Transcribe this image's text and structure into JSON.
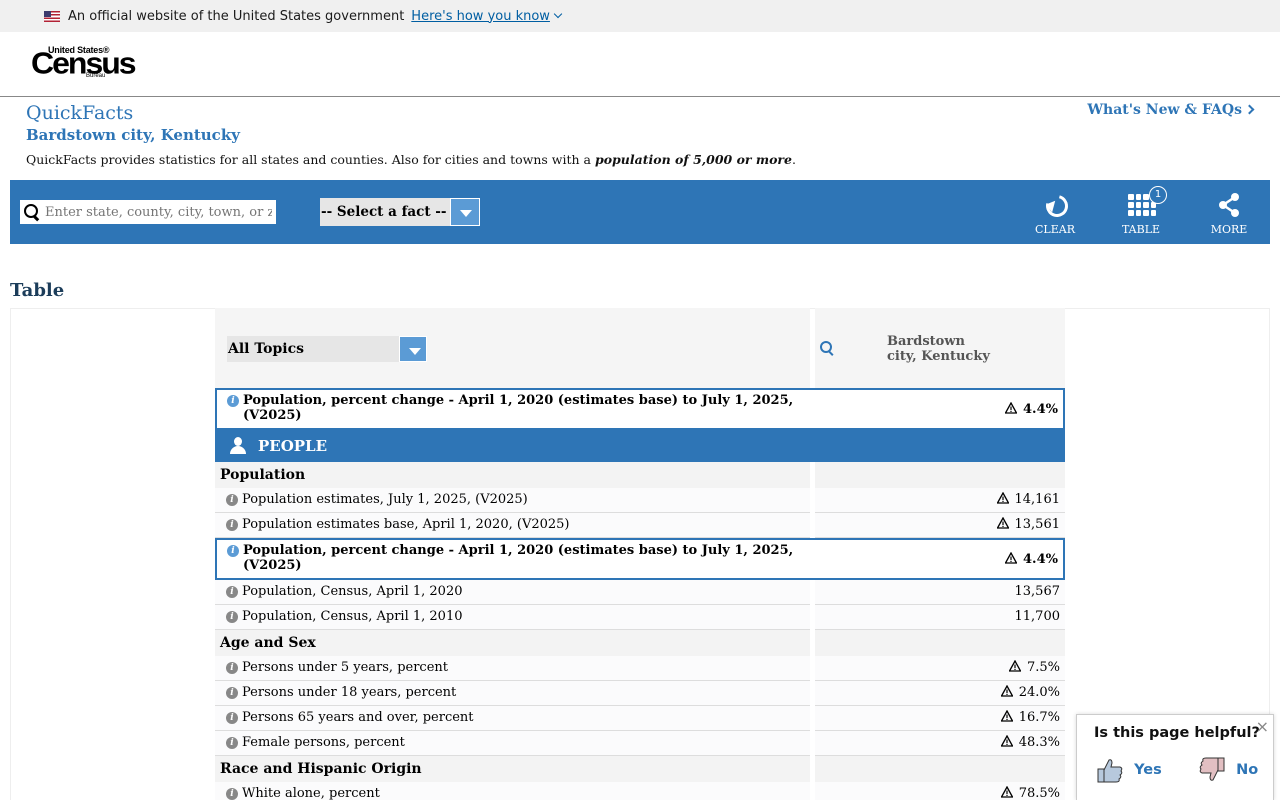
{
  "gov_banner": {
    "text": "An official website of the United States government",
    "link": "Here's how you know"
  },
  "logo": {
    "line1": "United States®",
    "line2": "Census",
    "line3": "Bureau"
  },
  "page": {
    "title": "QuickFacts",
    "subtitle": "Bardstown city, Kentucky",
    "whats_new": "What's New & FAQs",
    "description": "QuickFacts provides statistics for all states and counties. Also for cities and towns with a",
    "description_em": "population of 5,000 or more",
    "description_end": "."
  },
  "toolbar": {
    "search_placeholder": "Enter state, county, city, town, or zip code",
    "select_fact": "-- Select a fact --",
    "clear": "CLEAR",
    "table": "TABLE",
    "table_count": "1",
    "more": "MORE"
  },
  "table_heading": "Table",
  "table": {
    "topics": "All Topics",
    "column_line1": "Bardstown",
    "column_line2": "city, Kentucky",
    "highlight_top": {
      "label_line1": "Population, percent change - April 1, 2020 (estimates base) to July 1, 2025,",
      "label_line2": "(V2025)",
      "value": "4.4%"
    },
    "section": "PEOPLE",
    "groups": [
      {
        "category": "Population",
        "rows": [
          {
            "label": "Population estimates, July 1, 2025, (V2025)",
            "value": "14,161",
            "warn": true
          },
          {
            "label": "Population estimates base, April 1, 2020, (V2025)",
            "value": "13,561",
            "warn": true
          }
        ]
      }
    ],
    "highlight_mid": {
      "label_line1": "Population, percent change - April 1, 2020 (estimates base) to July 1, 2025,",
      "label_line2": "(V2025)",
      "value": "4.4%"
    },
    "pop_rows": [
      {
        "label": "Population, Census, April 1, 2020",
        "value": "13,567"
      },
      {
        "label": "Population, Census, April 1, 2010",
        "value": "11,700"
      }
    ],
    "age_category": "Age and Sex",
    "age_rows": [
      {
        "label": "Persons under 5 years, percent",
        "value": "7.5%"
      },
      {
        "label": "Persons under 18 years, percent",
        "value": "24.0%"
      },
      {
        "label": "Persons 65 years and over, percent",
        "value": "16.7%"
      },
      {
        "label": "Female persons, percent",
        "value": "48.3%"
      }
    ],
    "race_category": "Race and Hispanic Origin",
    "race_rows": [
      {
        "label": "White alone, percent",
        "value": "78.5%"
      }
    ]
  },
  "feedback": {
    "question": "Is this page helpful?",
    "yes": "Yes",
    "no": "No"
  },
  "colors": {
    "brand_blue": "#2e75b6",
    "light_blue": "#5b9bd5",
    "heading_navy": "#1c3d5a"
  }
}
